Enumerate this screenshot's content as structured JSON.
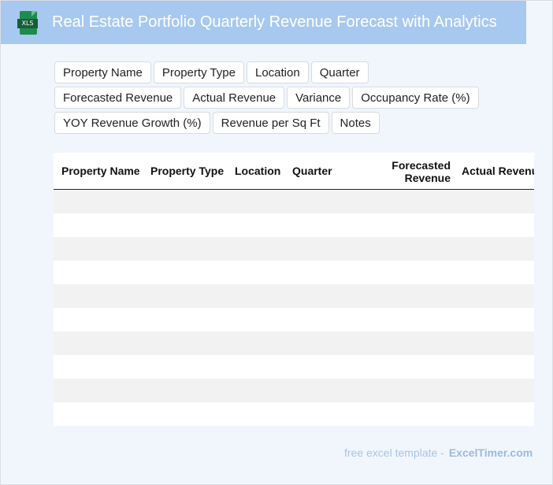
{
  "banner": {
    "title": "Real Estate Portfolio Quarterly Revenue Forecast with Analytics",
    "icon_label": "XLS",
    "icon": "xls-file-icon"
  },
  "chips": [
    "Property Name",
    "Property Type",
    "Location",
    "Quarter",
    "Forecasted Revenue",
    "Actual Revenue",
    "Variance",
    "Occupancy Rate (%)",
    "YOY Revenue Growth (%)",
    "Revenue per Sq Ft",
    "Notes"
  ],
  "table": {
    "headers": [
      "Property Name",
      "Property Type",
      "Location",
      "Quarter",
      "Forecasted Revenue",
      "Actual Revenu"
    ],
    "row_count": 10
  },
  "footer": {
    "prefix": "free excel template -",
    "brand": "ExcelTimer.com"
  },
  "colors": {
    "banner": "#a7c8ef",
    "page_bg": "#f1f6fd",
    "row_alt": "#f2f2f2",
    "icon_green": "#1e8b4e"
  }
}
